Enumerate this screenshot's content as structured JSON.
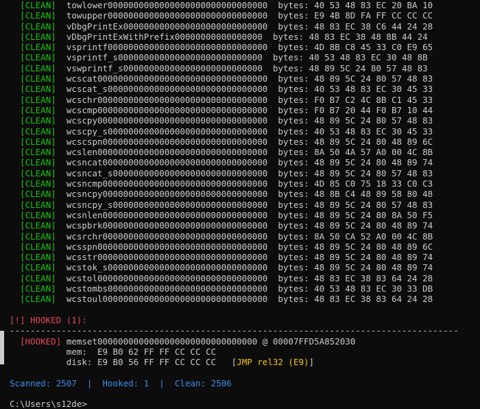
{
  "scan_lines": [
    {
      "tag": "[CLEAN]",
      "name": "towlower0000000000000000000000000000000",
      "bytes_label": "bytes:",
      "bytes": "40 53 48 83 EC 20 BA 10"
    },
    {
      "tag": "[CLEAN]",
      "name": "towupper0000000000000000000000000000000",
      "bytes_label": "bytes:",
      "bytes": "E9 4B 8D FA FF CC CC CC"
    },
    {
      "tag": "[CLEAN]",
      "name": "vDbgPrintEx0000000000000000000000000000",
      "bytes_label": "bytes:",
      "bytes": "48 83 EC 38 C6 44 24 28"
    },
    {
      "tag": "[CLEAN]",
      "name": "vDbgPrintExWithPrefix00000000000000000",
      "bytes_label": "bytes:",
      "bytes": "48 83 EC 38 48 8B 44 24"
    },
    {
      "tag": "[CLEAN]",
      "name": "vsprintf0000000000000000000000000000000",
      "bytes_label": "bytes:",
      "bytes": "4D 8B C8 45 33 C0 E9 65"
    },
    {
      "tag": "[CLEAN]",
      "name": "vsprintf_s0000000000000000000000000000",
      "bytes_label": "bytes:",
      "bytes": "40 53 48 83 EC 30 48 8B"
    },
    {
      "tag": "[CLEAN]",
      "name": "vswprintf_s000000000000000000000000000",
      "bytes_label": "bytes:",
      "bytes": "48 89 5C 24 80 57 48 83"
    },
    {
      "tag": "[CLEAN]",
      "name": "wcscat000000000000000000000000000000000",
      "bytes_label": "bytes:",
      "bytes": "48 89 5C 24 80 57 48 83"
    },
    {
      "tag": "[CLEAN]",
      "name": "wcscat_s0000000000000000000000000000000",
      "bytes_label": "bytes:",
      "bytes": "40 53 48 83 EC 30 45 33"
    },
    {
      "tag": "[CLEAN]",
      "name": "wcschr000000000000000000000000000000000",
      "bytes_label": "bytes:",
      "bytes": "F0 B7 C2 4C 8B C1 45 33"
    },
    {
      "tag": "[CLEAN]",
      "name": "wcscmp000000000000000000000000000000000",
      "bytes_label": "bytes:",
      "bytes": "F0 B7 20 44 F0 B7 10 44"
    },
    {
      "tag": "[CLEAN]",
      "name": "wcscpy000000000000000000000000000000000",
      "bytes_label": "bytes:",
      "bytes": "48 89 5C 24 80 57 48 83"
    },
    {
      "tag": "[CLEAN]",
      "name": "wcscpy_s0000000000000000000000000000000",
      "bytes_label": "bytes:",
      "bytes": "40 53 48 83 EC 30 45 33"
    },
    {
      "tag": "[CLEAN]",
      "name": "wcscspn00000000000000000000000000000000",
      "bytes_label": "bytes:",
      "bytes": "48 89 5C 24 80 48 89 6C"
    },
    {
      "tag": "[CLEAN]",
      "name": "wcslen000000000000000000000000000000000",
      "bytes_label": "bytes:",
      "bytes": "8A 50 4A 57 A0 00 4C 8B"
    },
    {
      "tag": "[CLEAN]",
      "name": "wcsncat00000000000000000000000000000000",
      "bytes_label": "bytes:",
      "bytes": "48 89 5C 24 80 48 89 74"
    },
    {
      "tag": "[CLEAN]",
      "name": "wcsncat_s000000000000000000000000000000",
      "bytes_label": "bytes:",
      "bytes": "48 89 5C 24 80 57 48 83"
    },
    {
      "tag": "[CLEAN]",
      "name": "wcsncmp00000000000000000000000000000000",
      "bytes_label": "bytes:",
      "bytes": "4D 85 C0 75 18 33 C0 C3"
    },
    {
      "tag": "[CLEAN]",
      "name": "wcsncpy00000000000000000000000000000000",
      "bytes_label": "bytes:",
      "bytes": "48 8B C4 48 89 58 80 48"
    },
    {
      "tag": "[CLEAN]",
      "name": "wcsncpy_s000000000000000000000000000000",
      "bytes_label": "bytes:",
      "bytes": "48 89 5C 24 80 57 48 83"
    },
    {
      "tag": "[CLEAN]",
      "name": "wcsnlen00000000000000000000000000000000",
      "bytes_label": "bytes:",
      "bytes": "48 89 5C 24 80 8A 50 F5"
    },
    {
      "tag": "[CLEAN]",
      "name": "wcspbrk00000000000000000000000000000000",
      "bytes_label": "bytes:",
      "bytes": "48 89 5C 24 80 48 89 74"
    },
    {
      "tag": "[CLEAN]",
      "name": "wcsrchr00000000000000000000000000000000",
      "bytes_label": "bytes:",
      "bytes": "8A 50 CA 52 A0 00 4C 8B"
    },
    {
      "tag": "[CLEAN]",
      "name": "wcsspn000000000000000000000000000000000",
      "bytes_label": "bytes:",
      "bytes": "48 89 5C 24 80 48 89 6C"
    },
    {
      "tag": "[CLEAN]",
      "name": "wcsstr000000000000000000000000000000000",
      "bytes_label": "bytes:",
      "bytes": "48 89 5C 24 80 48 89 74"
    },
    {
      "tag": "[CLEAN]",
      "name": "wcstok_s0000000000000000000000000000000",
      "bytes_label": "bytes:",
      "bytes": "48 89 5C 24 80 48 89 74"
    },
    {
      "tag": "[CLEAN]",
      "name": "wcstol000000000000000000000000000000000",
      "bytes_label": "bytes:",
      "bytes": "48 83 EC 38 83 64 24 28"
    },
    {
      "tag": "[CLEAN]",
      "name": "wcstombs0000000000000000000000000000000",
      "bytes_label": "bytes:",
      "bytes": "40 53 48 83 EC 30 33 DB"
    },
    {
      "tag": "[CLEAN]",
      "name": "wcstoul00000000000000000000000000000000",
      "bytes_label": "bytes:",
      "bytes": "48 83 EC 38 83 64 24 28"
    }
  ],
  "hooked_header": "[!] HOOKED (1):",
  "separator": "---------------------------------------------------------------------------------------",
  "hooked_entry": {
    "tag": "[HOOKED]",
    "name": "memset0000000000000000000000000000000",
    "at": "@",
    "address": "00007FFD5A852030",
    "mem_label": "mem:",
    "mem_bytes": "E9 B0 62 FF FF CC CC CC",
    "disk_label": "disk:",
    "disk_bytes": "E9 B0 56 FF FF CC CC CC",
    "note_open": "[",
    "note": "JMP rel32 (E9)",
    "note_close": "]"
  },
  "summary": {
    "scanned": "Scanned: 2507",
    "sep1": "|",
    "hooked": "Hooked: 1",
    "sep2": "|",
    "clean": "Clean: 2506"
  },
  "prompt": "C:\\Users\\s12de>",
  "colors": {
    "background": "#0c0c0c",
    "text": "#cccccc",
    "clean": "#16c60c",
    "hooked": "#e74856",
    "summary": "#3b8eea",
    "note": "#f9c513"
  }
}
